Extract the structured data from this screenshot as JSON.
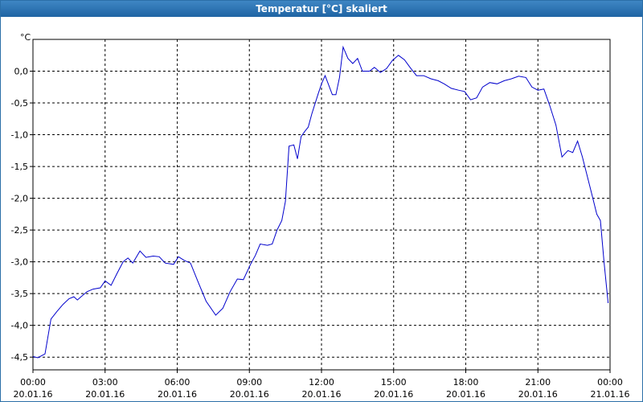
{
  "window": {
    "title": "Temperatur [°C] skaliert"
  },
  "colors": {
    "title_bar": "#1f64a3",
    "series": "#0000cc",
    "grid": "#000000"
  },
  "chart_data": {
    "type": "line",
    "title": "Temperatur [°C] skaliert",
    "ylabel": "°C",
    "ylim": [
      -4.7,
      0.5
    ],
    "grid": true,
    "legend": "none",
    "y_ticks": [
      {
        "value": 0.0,
        "label": "0,0"
      },
      {
        "value": -0.5,
        "label": "-0,5"
      },
      {
        "value": -1.0,
        "label": "-1,0"
      },
      {
        "value": -1.5,
        "label": "-1,5"
      },
      {
        "value": -2.0,
        "label": "-2,0"
      },
      {
        "value": -2.5,
        "label": "-2,5"
      },
      {
        "value": -3.0,
        "label": "-3,0"
      },
      {
        "value": -3.5,
        "label": "-3,5"
      },
      {
        "value": -4.0,
        "label": "-4,0"
      },
      {
        "value": -4.5,
        "label": "-4,5"
      }
    ],
    "x_ticks": [
      {
        "hour": 0,
        "time": "00:00",
        "date": "20.01.16"
      },
      {
        "hour": 3,
        "time": "03:00",
        "date": "20.01.16"
      },
      {
        "hour": 6,
        "time": "06:00",
        "date": "20.01.16"
      },
      {
        "hour": 9,
        "time": "09:00",
        "date": "20.01.16"
      },
      {
        "hour": 12,
        "time": "12:00",
        "date": "20.01.16"
      },
      {
        "hour": 15,
        "time": "15:00",
        "date": "20.01.16"
      },
      {
        "hour": 18,
        "time": "18:00",
        "date": "20.01.16"
      },
      {
        "hour": 21,
        "time": "21:00",
        "date": "20.01.16"
      },
      {
        "hour": 24,
        "time": "00:00",
        "date": "21.01.16"
      }
    ],
    "xlim": [
      0,
      24
    ],
    "series": [
      {
        "color": "#0000cc",
        "points": [
          [
            0.0,
            -4.49
          ],
          [
            0.2,
            -4.51
          ],
          [
            0.5,
            -4.45
          ],
          [
            0.75,
            -3.9
          ],
          [
            1.0,
            -3.78
          ],
          [
            1.25,
            -3.67
          ],
          [
            1.5,
            -3.58
          ],
          [
            1.7,
            -3.55
          ],
          [
            1.85,
            -3.6
          ],
          [
            2.0,
            -3.55
          ],
          [
            2.25,
            -3.47
          ],
          [
            2.5,
            -3.43
          ],
          [
            2.8,
            -3.41
          ],
          [
            3.0,
            -3.3
          ],
          [
            3.25,
            -3.37
          ],
          [
            3.5,
            -3.18
          ],
          [
            3.75,
            -3.0
          ],
          [
            3.95,
            -2.94
          ],
          [
            4.15,
            -3.02
          ],
          [
            4.45,
            -2.83
          ],
          [
            4.7,
            -2.93
          ],
          [
            5.0,
            -2.91
          ],
          [
            5.25,
            -2.92
          ],
          [
            5.5,
            -3.02
          ],
          [
            5.85,
            -3.04
          ],
          [
            6.05,
            -2.92
          ],
          [
            6.3,
            -2.98
          ],
          [
            6.55,
            -3.02
          ],
          [
            6.85,
            -3.3
          ],
          [
            7.2,
            -3.62
          ],
          [
            7.6,
            -3.84
          ],
          [
            7.9,
            -3.73
          ],
          [
            8.2,
            -3.47
          ],
          [
            8.5,
            -3.27
          ],
          [
            8.75,
            -3.28
          ],
          [
            9.05,
            -3.04
          ],
          [
            9.25,
            -2.9
          ],
          [
            9.45,
            -2.72
          ],
          [
            9.75,
            -2.74
          ],
          [
            9.95,
            -2.72
          ],
          [
            10.15,
            -2.5
          ],
          [
            10.35,
            -2.35
          ],
          [
            10.5,
            -2.05
          ],
          [
            10.65,
            -1.18
          ],
          [
            10.85,
            -1.16
          ],
          [
            11.0,
            -1.38
          ],
          [
            11.15,
            -1.03
          ],
          [
            11.3,
            -0.95
          ],
          [
            11.45,
            -0.88
          ],
          [
            11.6,
            -0.67
          ],
          [
            11.85,
            -0.37
          ],
          [
            12.0,
            -0.2
          ],
          [
            12.15,
            -0.07
          ],
          [
            12.3,
            -0.22
          ],
          [
            12.45,
            -0.37
          ],
          [
            12.6,
            -0.37
          ],
          [
            12.75,
            -0.1
          ],
          [
            12.9,
            0.38
          ],
          [
            13.1,
            0.2
          ],
          [
            13.3,
            0.12
          ],
          [
            13.5,
            0.2
          ],
          [
            13.7,
            0.0
          ],
          [
            14.0,
            0.0
          ],
          [
            14.2,
            0.06
          ],
          [
            14.45,
            -0.02
          ],
          [
            14.7,
            0.04
          ],
          [
            14.95,
            0.17
          ],
          [
            15.2,
            0.25
          ],
          [
            15.45,
            0.18
          ],
          [
            15.7,
            0.05
          ],
          [
            15.95,
            -0.07
          ],
          [
            16.25,
            -0.07
          ],
          [
            16.55,
            -0.12
          ],
          [
            16.85,
            -0.15
          ],
          [
            17.1,
            -0.2
          ],
          [
            17.4,
            -0.27
          ],
          [
            17.7,
            -0.3
          ],
          [
            17.95,
            -0.32
          ],
          [
            18.2,
            -0.45
          ],
          [
            18.45,
            -0.42
          ],
          [
            18.7,
            -0.25
          ],
          [
            19.0,
            -0.18
          ],
          [
            19.3,
            -0.2
          ],
          [
            19.6,
            -0.15
          ],
          [
            19.9,
            -0.12
          ],
          [
            20.2,
            -0.08
          ],
          [
            20.5,
            -0.1
          ],
          [
            20.75,
            -0.25
          ],
          [
            21.0,
            -0.3
          ],
          [
            21.25,
            -0.28
          ],
          [
            21.5,
            -0.55
          ],
          [
            21.75,
            -0.85
          ],
          [
            22.0,
            -1.35
          ],
          [
            22.25,
            -1.25
          ],
          [
            22.45,
            -1.28
          ],
          [
            22.65,
            -1.1
          ],
          [
            22.85,
            -1.35
          ],
          [
            23.05,
            -1.65
          ],
          [
            23.25,
            -1.95
          ],
          [
            23.45,
            -2.25
          ],
          [
            23.6,
            -2.35
          ],
          [
            23.75,
            -3.0
          ],
          [
            23.92,
            -3.65
          ]
        ]
      }
    ]
  }
}
